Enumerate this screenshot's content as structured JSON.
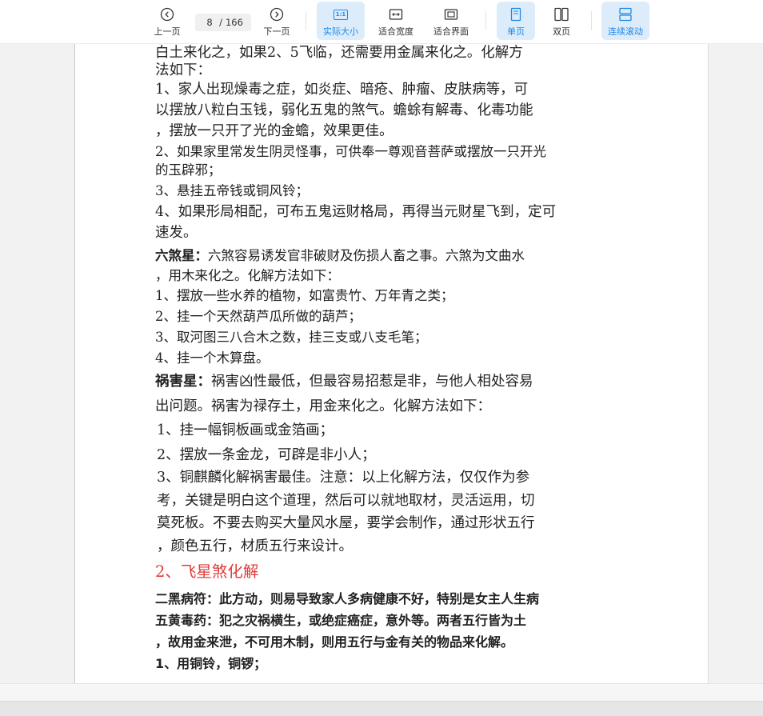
{
  "toolbar": {
    "prev_label": "上一页",
    "next_label": "下一页",
    "current_page": "8",
    "page_separator": "/",
    "total_pages": "166",
    "actual_size_label": "实际大小",
    "actual_size_icon_text": "1:1",
    "fit_width_label": "适合宽度",
    "fit_page_label": "适合界面",
    "single_page_label": "单页",
    "double_page_label": "双页",
    "continuous_scroll_label": "连续滚动",
    "accent_color": "#1e88e5"
  },
  "document": {
    "lines": [
      {
        "text": "白土来化之，如果2、5飞临，还需要用金属来化之。化解方"
      },
      {
        "text": "法如下："
      },
      {
        "text": "1、家人出现燥毒之症，如炎症、暗疮、肿瘤、皮肤病等，可"
      },
      {
        "text": "以摆放八粒白玉钱，弱化五鬼的煞气。蟾蜍有解毒、化毒功能"
      },
      {
        "text": "，摆放一只开了光的金蟾，效果更佳。"
      },
      {
        "text": "2、如果家里常发生阴灵怪事，可供奉一尊观音菩萨或摆放一只开光"
      },
      {
        "text": "的玉辟邪；"
      },
      {
        "text": "3、悬挂五帝钱或铜风铃；"
      },
      {
        "text": "4、如果形局相配，可布五鬼运财格局，再得当元财星飞到，定可"
      },
      {
        "text": "速发。"
      },
      {
        "bold": "六煞星：",
        "text": "六煞容易诱发官非破财及伤损人畜之事。六煞为文曲水"
      },
      {
        "text": "，用木来化之。化解方法如下："
      },
      {
        "text": "1、摆放一些水养的植物，如富贵竹、万年青之类；"
      },
      {
        "text": "2、挂一个天然葫芦瓜所做的葫芦；"
      },
      {
        "text": "3、取河图三八合木之数，挂三支或八支毛笔；"
      },
      {
        "text": "4、挂一个木算盘。"
      },
      {
        "bold": "祸害星：",
        "text": "祸害凶性最低，但最容易招惹是非，与他人相处容易"
      },
      {
        "text": "出问题。祸害为禄存土，用金来化之。化解方法如下："
      },
      {
        "text": "1、挂一幅铜板画或金箔画；"
      },
      {
        "text": "2、摆放一条金龙，可辟是非小人；"
      },
      {
        "text": "3、铜麒麟化解祸害最佳。注意：以上化解方法，仅仅作为参"
      },
      {
        "text": "考，关键是明白这个道理，然后可以就地取材，灵活运用，切"
      },
      {
        "text": "莫死板。不要去购买大量风水屋，要学会制作，通过形状五行"
      },
      {
        "text": "，颜色五行，材质五行来设计。"
      },
      {
        "text": "2、飞星煞化解"
      },
      {
        "text": "二黑病符：此方动，则易导致家人多病健康不好，特别是女主人生病"
      },
      {
        "text": "五黄毒药：犯之灾祸横生，或绝症癌症，意外等。两者五行皆为土"
      },
      {
        "text": "，故用金来泄，不可用木制，则用五行与金有关的物品来化解。"
      },
      {
        "text": "1、用铜铃，铜锣；"
      }
    ]
  }
}
